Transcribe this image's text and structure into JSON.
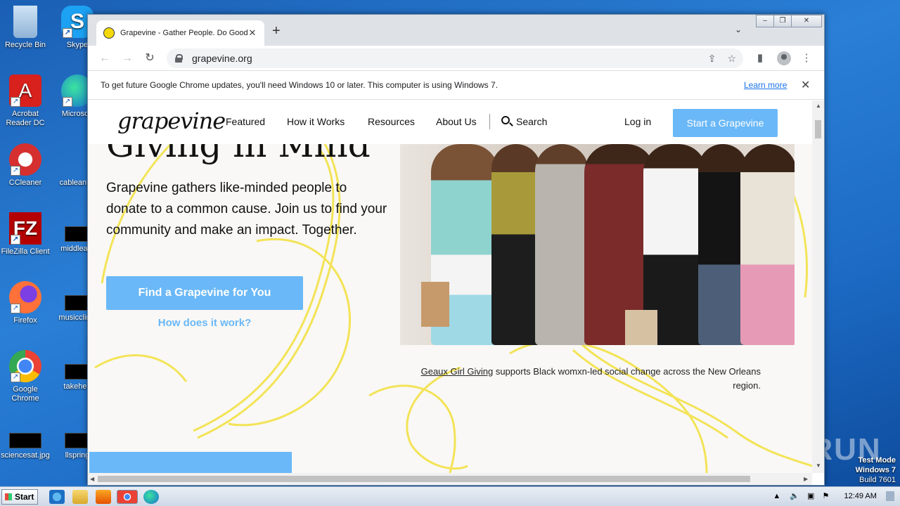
{
  "desktop": {
    "icons": [
      {
        "label": "Recycle Bin"
      },
      {
        "label": "Skype"
      },
      {
        "label": "Acrobat Reader DC"
      },
      {
        "label": "Microsoft"
      },
      {
        "label": "CCleaner"
      },
      {
        "label": "cableannu"
      },
      {
        "label": "FileZilla Client"
      },
      {
        "label": "middleam"
      },
      {
        "label": "Firefox"
      },
      {
        "label": "musicclinic"
      },
      {
        "label": "Google Chrome"
      },
      {
        "label": "takeher."
      },
      {
        "label": "sciencesat.jpg"
      },
      {
        "label": "llspring"
      }
    ],
    "watermark": "ANY RUN",
    "test_mode": {
      "line1": "Test Mode",
      "line2": "Windows 7",
      "line3": "Build 7601"
    }
  },
  "browser": {
    "tab_title": "Grapevine - Gather People. Do Good",
    "url": "grapevine.org",
    "infobar": {
      "message": "To get future Google Chrome updates, you'll need Windows 10 or later. This computer is using Windows 7.",
      "link": "Learn more"
    }
  },
  "site": {
    "logo": "grapevine",
    "nav": {
      "featured": "Featured",
      "how_it_works": "How it Works",
      "resources": "Resources",
      "about_us": "About Us",
      "search": "Search",
      "login": "Log in",
      "cta": "Start a Grapevine"
    },
    "hero": {
      "title": "Giving in Mind",
      "body": "Grapevine gathers like-minded people to donate to a common cause. Join us to find your community and make an impact. Together.",
      "find_button": "Find a Grapevine for You",
      "how_link": "How does it work?"
    },
    "caption": {
      "link": "Geaux Girl Giving",
      "text": " supports Black womxn-led social change across the New Orleans region."
    },
    "colors": {
      "accent": "#6ab8f7",
      "swirl": "#f2e03c"
    }
  },
  "taskbar": {
    "start": "Start",
    "clock": "12:49 AM"
  }
}
